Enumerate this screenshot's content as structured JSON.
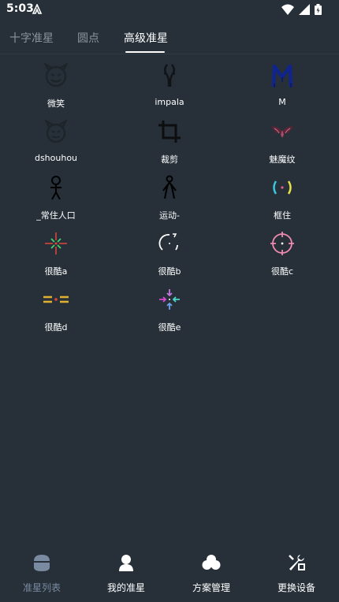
{
  "status_bar": {
    "time": "5:03"
  },
  "tabs": [
    {
      "label": "十字准星"
    },
    {
      "label": "圆点"
    },
    {
      "label": "高级准星"
    }
  ],
  "crosshairs": [
    {
      "label": "微笑",
      "icon": "smiley-devil-icon"
    },
    {
      "label": "impala",
      "icon": "impala-horns-icon"
    },
    {
      "label": "M",
      "icon": "letter-m-icon"
    },
    {
      "label": "dshouhou",
      "icon": "devil-face-icon"
    },
    {
      "label": "裁剪",
      "icon": "crop-icon"
    },
    {
      "label": "魅魔纹",
      "icon": "succubus-mark-icon"
    },
    {
      "label": "_常住人口",
      "icon": "stick-figure-icon"
    },
    {
      "label": "运动-",
      "icon": "running-figure-icon"
    },
    {
      "label": "框住",
      "icon": "bracket-frame-icon"
    },
    {
      "label": "很酷a",
      "icon": "cool-cross-a-icon"
    },
    {
      "label": "很酷b",
      "icon": "cool-arc-b-icon"
    },
    {
      "label": "很酷c",
      "icon": "cool-circle-c-icon"
    },
    {
      "label": "很酷d",
      "icon": "cool-dash-d-icon"
    },
    {
      "label": "很酷e",
      "icon": "cool-arrows-e-icon"
    }
  ],
  "bottom_nav": [
    {
      "label": "准星列表",
      "icon": "crosshair-list-icon"
    },
    {
      "label": "我的准星",
      "icon": "user-icon"
    },
    {
      "label": "方案管理",
      "icon": "cloud-icon"
    },
    {
      "label": "更换设备",
      "icon": "swap-device-icon"
    }
  ],
  "colors": {
    "background": "#273039",
    "active_nav": "#7a8aa0",
    "inactive_tab": "#8a949c"
  }
}
